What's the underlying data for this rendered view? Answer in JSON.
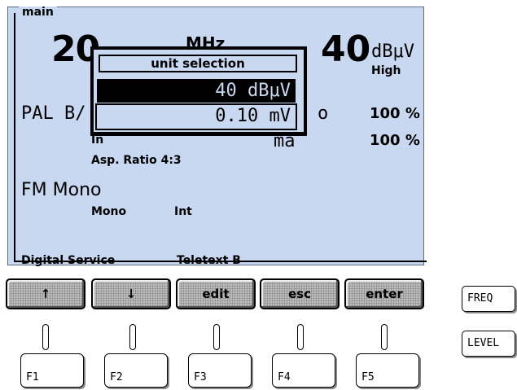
{
  "screen": {
    "title": "main",
    "frequency": {
      "value": "20",
      "unit": "MHz"
    },
    "level": {
      "value": "40",
      "unit": "dBμV",
      "mode": "High"
    },
    "standard": "PAL B/",
    "video": {
      "label": "o",
      "value": "100 %"
    },
    "chroma": {
      "label": "ma",
      "value": "100 %"
    },
    "in_label": "In",
    "aspect": "Asp. Ratio 4:3",
    "fm": {
      "title": "FM Mono",
      "mode": "Mono",
      "source": "Int"
    },
    "digital_service": {
      "label": "Digital Service",
      "value": "Teletext B"
    }
  },
  "popup": {
    "title": "unit selection",
    "options": [
      "40 dBμV",
      "0.10 mV"
    ],
    "selected_index": 0
  },
  "softkeys": [
    "↑",
    "↓",
    "edit",
    "esc",
    "enter"
  ],
  "fkeys": [
    "F1",
    "F2",
    "F3",
    "F4",
    "F5"
  ],
  "side_keys": [
    "FREQ",
    "LEVEL"
  ]
}
